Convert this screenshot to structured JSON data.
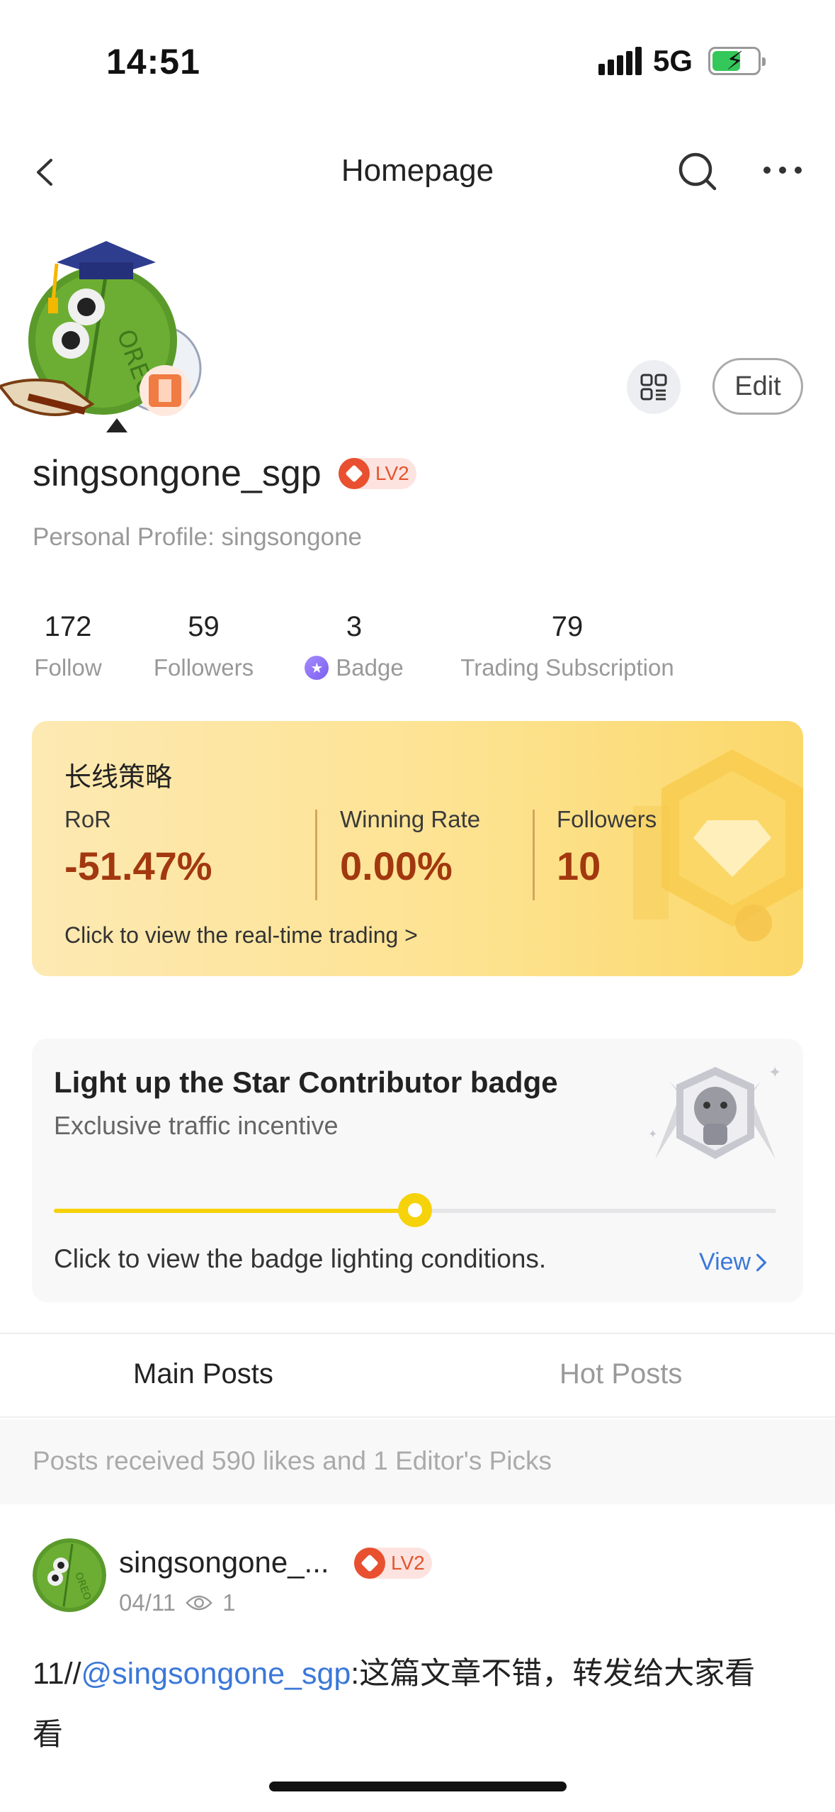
{
  "status_bar": {
    "time": "14:51",
    "network": "5G"
  },
  "nav": {
    "title": "Homepage",
    "back_icon": "chevron-left-icon",
    "search_icon": "search-icon",
    "more_icon": "more-icon"
  },
  "profile": {
    "edit_label": "Edit",
    "username": "singsongone_sgp",
    "level": "LV2",
    "personal_profile": "Personal Profile: singsongone"
  },
  "stats": [
    {
      "value": "172",
      "label": "Follow"
    },
    {
      "value": "59",
      "label": "Followers"
    },
    {
      "value": "3",
      "label": "Badge"
    },
    {
      "value": "79",
      "label": "Trading Subscription"
    }
  ],
  "strategy": {
    "title": "长线策略",
    "columns": [
      {
        "label": "RoR",
        "value": "-51.47%"
      },
      {
        "label": "Winning Rate",
        "value": "0.00%"
      },
      {
        "label": "Followers",
        "value": "10"
      }
    ],
    "link": "Click to view the real-time trading >"
  },
  "badge_card": {
    "title": "Light up the Star Contributor badge",
    "subtitle": "Exclusive traffic incentive",
    "progress": 0.5,
    "condition": "Click to view the badge lighting conditions.",
    "view_label": "View"
  },
  "tabs": [
    {
      "label": "Main Posts",
      "active": true
    },
    {
      "label": "Hot Posts",
      "active": false
    }
  ],
  "summary": "Posts received 590 likes and 1 Editor's Picks",
  "post": {
    "author": "singsongone_...",
    "level": "LV2",
    "date": "04/11",
    "views": "1",
    "prefix": "11//",
    "mention": "@singsongone_sgp",
    "text_line1": ":这篇文章不错，转发给大家看",
    "text_line2": "看"
  },
  "colors": {
    "accent_blue": "#3b78d8",
    "value_brown": "#a2380f",
    "progress_yellow": "#f6d20a"
  }
}
